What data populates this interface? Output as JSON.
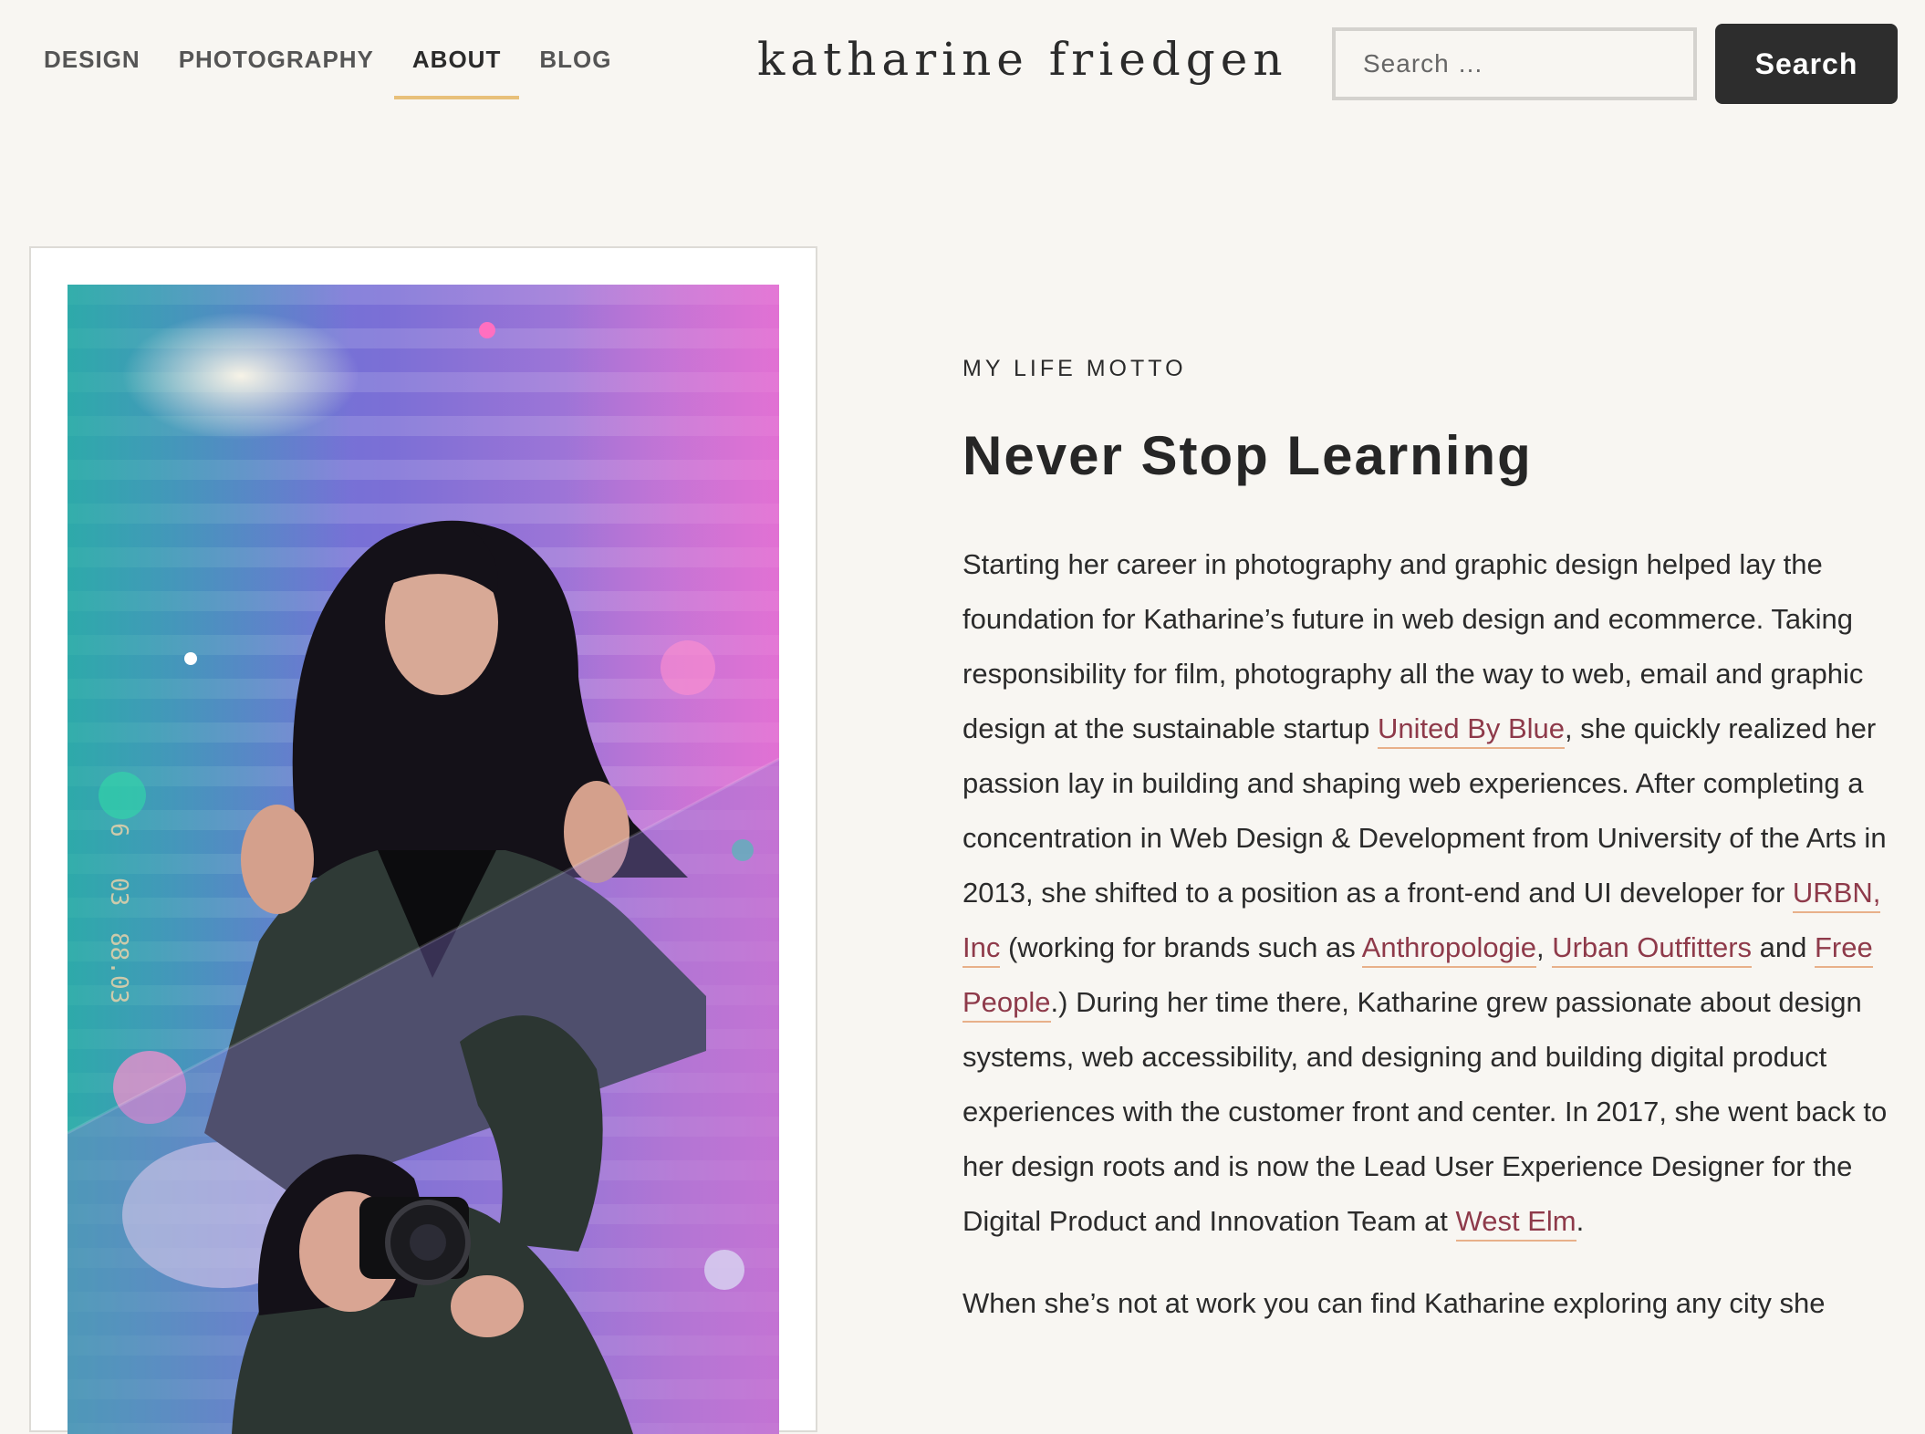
{
  "nav": {
    "items": [
      {
        "label": "DESIGN",
        "active": false
      },
      {
        "label": "PHOTOGRAPHY",
        "active": false
      },
      {
        "label": "ABOUT",
        "active": true
      },
      {
        "label": "BLOG",
        "active": false
      }
    ]
  },
  "brand": {
    "title": "katharine friedgen"
  },
  "search": {
    "placeholder": "Search …",
    "button_label": "Search"
  },
  "photo": {
    "film_marks": [
      "6",
      "03",
      "88.03"
    ]
  },
  "about": {
    "eyebrow": "MY LIFE MOTTO",
    "headline": "Never Stop Learning",
    "p1": {
      "t1": "Starting her career in photography and graphic design helped lay the foundation for Katharine’s future in web design and ecommerce. Taking responsibility for film, photography all the way to web, email and graphic design at the sustainable startup ",
      "link_united_by_blue": "United By Blue",
      "t2": ", she quickly realized her passion lay in building and shaping web experiences. After completing a concentration in Web Design & Development from University of the Arts in 2013, she shifted to a position as a front-end and UI developer for ",
      "link_urbn": "URBN, Inc",
      "t3": " (working for brands such as ",
      "link_anthropologie": "Anthropologie",
      "t4": ", ",
      "link_urban_outfitters": "Urban Outfitters",
      "t5": " and ",
      "link_free_people": "Free People",
      "t6": ".) During her time there, Katharine grew passionate about design systems, web accessibility, and designing and building digital product experiences with the customer front and center. In 2017, she went back to her design roots and is now the Lead User Experience Designer for the Digital Product and Innovation Team at ",
      "link_west_elm": "West Elm",
      "t7": "."
    },
    "p2": "When she’s not at work you can find Katharine exploring any city she"
  },
  "colors": {
    "background": "#f8f6f2",
    "link": "#8e3a4a",
    "link_underline": "#e8b08a",
    "nav_active_underline": "#e8c07a",
    "button_bg": "#2d2d2d"
  }
}
